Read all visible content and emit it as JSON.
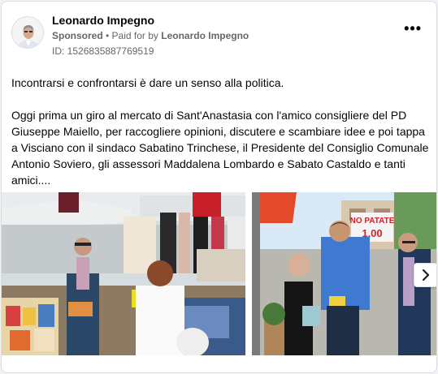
{
  "ad": {
    "advertiser": "Leonardo Impegno",
    "sponsored": "Sponsored",
    "paid_prefix": "• Paid for by",
    "payer": "Leonardo Impegno",
    "id_text": "ID: 1526835887769519"
  },
  "body": {
    "para1": "Incontrarsi e confrontarsi è dare un senso alla politica.",
    "para2": "Oggi prima un giro al mercato di Sant'Anastasia con l'amico consigliere del PD Giuseppe Maiello, per raccogliere opinioni, discutere e scambiare idee e poi tappa a Visciano con il sindaco Sabatino Trinchese, il Presidente del Consiglio Comunale Antonio Soviero, gli assessori Maddalena Lombardo e Sabato Castaldo e tanti amici...."
  },
  "carousel": {
    "sign_line1": "NO PATATE",
    "sign_line2": "1,00"
  },
  "icons": {
    "more": "more-options-icon",
    "next": "chevron-right-icon"
  }
}
